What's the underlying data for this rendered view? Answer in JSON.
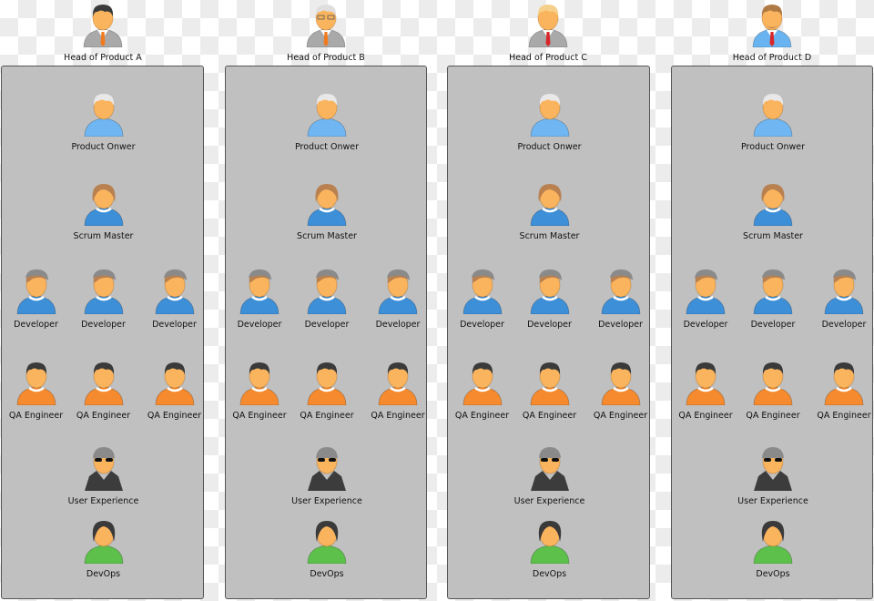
{
  "heads": [
    {
      "label": "Head of Product A",
      "hair": "#3a3a3a",
      "body": "#a9a9a9",
      "tie": "#f07a1e",
      "beard": false
    },
    {
      "label": "Head of Product B",
      "hair": "#dedede",
      "body": "#a9a9a9",
      "tie": "#f07a1e",
      "beard": false,
      "glasses": true
    },
    {
      "label": "Head of Product C",
      "hair": "#f6d08a",
      "body": "#a9a9a9",
      "tie": "#d8262a",
      "beard": false
    },
    {
      "label": "Head of Product D",
      "hair": "#b07a45",
      "body": "#69b4f0",
      "tie": "#d8262a",
      "beard": true
    }
  ],
  "panels": [
    {
      "members": [
        {
          "label": "Product Onwer",
          "kind": "po"
        },
        {
          "label": "Scrum Master",
          "kind": "sm"
        },
        {
          "label": "Developer",
          "kind": "dev"
        },
        {
          "label": "Developer",
          "kind": "dev"
        },
        {
          "label": "Developer",
          "kind": "dev"
        },
        {
          "label": "QA Engineer",
          "kind": "qa"
        },
        {
          "label": "QA Engineer",
          "kind": "qa"
        },
        {
          "label": "QA Engineer",
          "kind": "qa"
        },
        {
          "label": "User Experience",
          "kind": "ux"
        },
        {
          "label": "DevOps",
          "kind": "devops"
        }
      ]
    },
    {
      "members": [
        {
          "label": "Product Onwer",
          "kind": "po"
        },
        {
          "label": "Scrum Master",
          "kind": "sm"
        },
        {
          "label": "Developer",
          "kind": "dev"
        },
        {
          "label": "Developer",
          "kind": "dev"
        },
        {
          "label": "Developer",
          "kind": "dev"
        },
        {
          "label": "QA Engineer",
          "kind": "qa"
        },
        {
          "label": "QA Engineer",
          "kind": "qa"
        },
        {
          "label": "QA Engineer",
          "kind": "qa"
        },
        {
          "label": "User Experience",
          "kind": "ux"
        },
        {
          "label": "DevOps",
          "kind": "devops"
        }
      ]
    },
    {
      "members": [
        {
          "label": "Product Onwer",
          "kind": "po"
        },
        {
          "label": "Scrum Master",
          "kind": "sm"
        },
        {
          "label": "Developer",
          "kind": "dev"
        },
        {
          "label": "Developer",
          "kind": "dev"
        },
        {
          "label": "Developer",
          "kind": "dev"
        },
        {
          "label": "QA Engineer",
          "kind": "qa"
        },
        {
          "label": "QA Engineer",
          "kind": "qa"
        },
        {
          "label": "QA Engineer",
          "kind": "qa"
        },
        {
          "label": "User Experience",
          "kind": "ux"
        },
        {
          "label": "DevOps",
          "kind": "devops"
        }
      ]
    },
    {
      "members": [
        {
          "label": "Product Onwer",
          "kind": "po"
        },
        {
          "label": "Scrum Master",
          "kind": "sm"
        },
        {
          "label": "Developer",
          "kind": "dev"
        },
        {
          "label": "Developer",
          "kind": "dev"
        },
        {
          "label": "Developer",
          "kind": "dev"
        },
        {
          "label": "QA Engineer",
          "kind": "qa"
        },
        {
          "label": "QA Engineer",
          "kind": "qa"
        },
        {
          "label": "QA Engineer",
          "kind": "qa"
        },
        {
          "label": "User Experience",
          "kind": "ux"
        },
        {
          "label": "DevOps",
          "kind": "devops"
        }
      ]
    }
  ],
  "role_colors": {
    "po": {
      "hair": "#e8e8e8",
      "body": "#6fb6f2"
    },
    "sm": {
      "hair": "#b98050",
      "body": "#3d8fd8"
    },
    "dev": {
      "hair": "#b98050",
      "body": "#3d8fd8",
      "cap": "#8a8a8a"
    },
    "qa": {
      "hair": "#3a3a3a",
      "body": "#f58a2e"
    },
    "ux": {
      "hair": "#8a8a8a",
      "body": "#3c3c3c"
    },
    "devops": {
      "hair": "#3a3a3a",
      "body": "#5cc04a"
    }
  },
  "skin": "#fbb45e"
}
